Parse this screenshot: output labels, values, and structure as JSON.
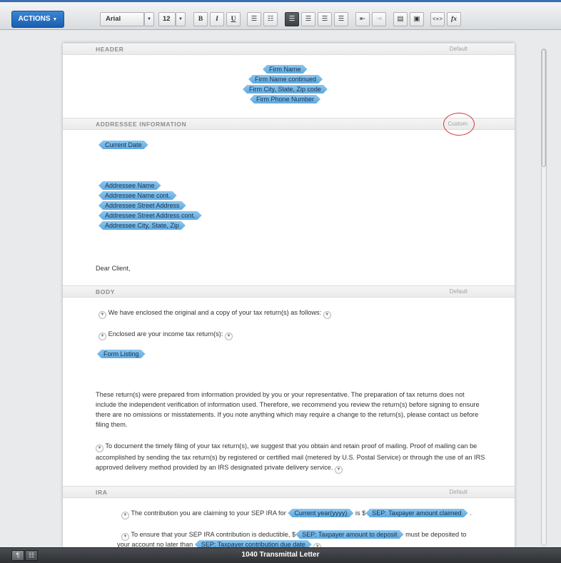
{
  "toolbar": {
    "actions_label": "ACTIONS",
    "font_name": "Arial",
    "font_size": "12",
    "bold": "B",
    "italic": "I",
    "underline": "U",
    "fx": "fx",
    "code": "<+>"
  },
  "sections": {
    "header": {
      "title": "HEADER",
      "mode": "Default"
    },
    "addressee": {
      "title": "ADDRESSEE INFORMATION",
      "mode": "Custom"
    },
    "body": {
      "title": "BODY",
      "mode": "Default"
    },
    "ira": {
      "title": "IRA",
      "mode": "Default"
    }
  },
  "header_fields": [
    "Firm Name",
    "Firm Name continued",
    "Firm City, State, Zip code",
    "Firm Phone Number"
  ],
  "addressee": {
    "date_field": "Current Date",
    "fields": [
      "Addressee Name",
      "Addressee Name cont.",
      "Addressee Street Address",
      "Addressee Street Address cont.",
      "Addressee City, State, Zip"
    ],
    "salutation": "Dear Client,"
  },
  "body": {
    "line1": "We have enclosed the original and a copy of your tax return(s) as follows:",
    "line2": "Enclosed are your income tax return(s):",
    "form_listing": "Form Listing",
    "para1": "These return(s) were prepared from information provided by you or your representative.  The preparation of tax returns does not include the independent verification of information used.  Therefore, we recommend you review the return(s) before signing to ensure there are no omissions or misstatements.  If you note anything which may require a change to the return(s), please contact us before filing them.",
    "para2": "To document the timely filing of your tax return(s), we suggest that you obtain and retain proof of mailing.  Proof of mailing can be accomplished by sending the tax return(s) by registered or certified mail (metered by U.S. Postal Service) or through the use of an IRS approved delivery method provided by an IRS designated private delivery service."
  },
  "ira": {
    "l1_a": "The contribution you are claiming to your SEP IRA for",
    "l1_field1": "Current year(yyyy)",
    "l1_b": "is $",
    "l1_field2": "SEP: Taxpayer amount claimed",
    "l1_c": ".",
    "l2_a": "To ensure that your SEP IRA contribution is deductible, $",
    "l2_field1": "SEP: Taxpayer amount to deposit",
    "l2_b": "must be deposited to",
    "l3_a": "your account no later than",
    "l3_field1": "SEP: Taxpayer contribution due date"
  },
  "footer": {
    "document_title": "1040 Transmittal Letter"
  },
  "colors": {
    "accent": "#1a5eb0",
    "field_tag": "#6fb4e6",
    "highlight_circle": "#d23a3a"
  }
}
